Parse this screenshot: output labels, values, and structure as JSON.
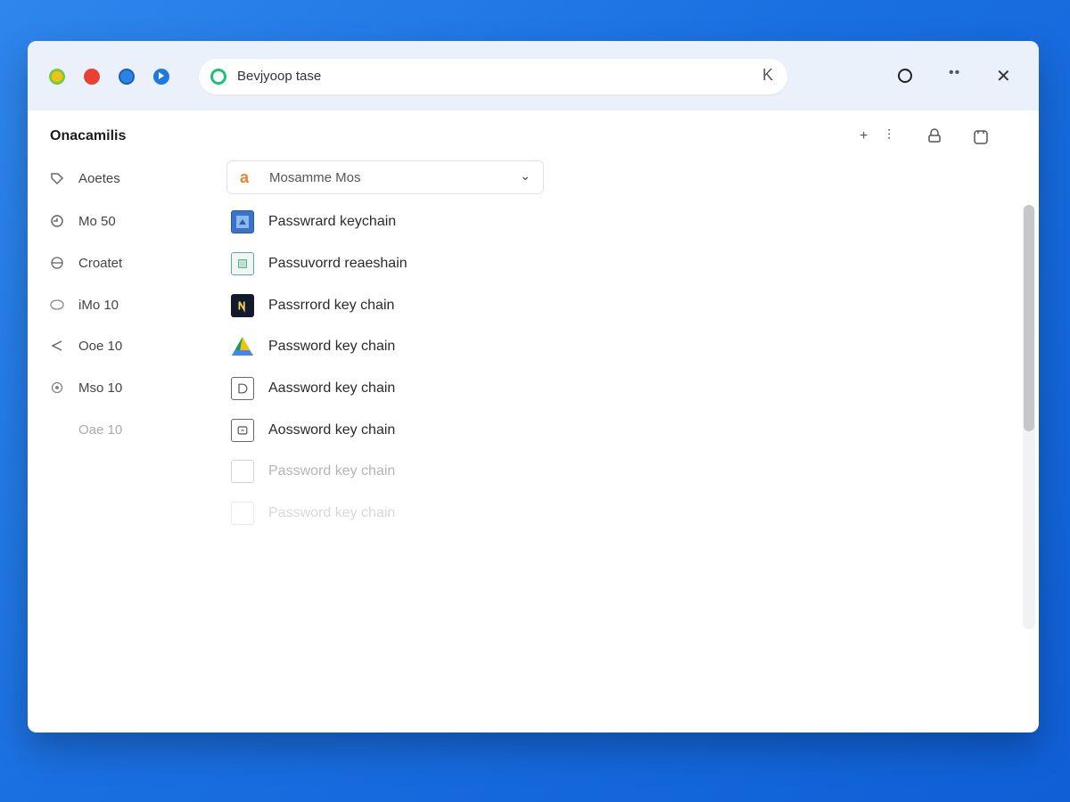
{
  "titlebar": {
    "url_text": "Bevjyoop tase",
    "url_clear_glyph": "K"
  },
  "app": {
    "title": "Onacamilis"
  },
  "sidebar": {
    "items": [
      {
        "label": "Aoetes",
        "icon": "tag-icon"
      },
      {
        "label": "Mo 50",
        "icon": "clock-icon"
      },
      {
        "label": "Croatet",
        "icon": "globe-icon"
      },
      {
        "label": "iMo 10",
        "icon": "oval-icon"
      },
      {
        "label": "Ooe 10",
        "icon": "back-arrow-icon"
      },
      {
        "label": "Mso 10",
        "icon": "settings-icon"
      },
      {
        "label": "Oae 10",
        "icon": "none"
      }
    ]
  },
  "dropdown": {
    "label": "Mosamme Mos",
    "icon": "a-logo-icon",
    "accent": "#e8832c"
  },
  "entries": [
    {
      "label": "Passwrard keychain",
      "icon": "blue-app-icon"
    },
    {
      "label": "Passuvorrd reaeshain",
      "icon": "green-box-icon"
    },
    {
      "label": "Passrrord key chain",
      "icon": "dark-app-icon"
    },
    {
      "label": "Password key chain",
      "icon": "triangle-drive-icon"
    },
    {
      "label": "Aassword key chain",
      "icon": "outline-d-icon"
    },
    {
      "label": "Aossword key chain",
      "icon": "outline-square-icon"
    },
    {
      "label": "Password key chain",
      "icon": "doc-icon"
    },
    {
      "label": "Password key chain",
      "icon": "doc-icon"
    }
  ],
  "colors": {
    "background": "#1a6fe0",
    "titlebar": "#eaf1fb",
    "accent_green": "#1fbf77",
    "red": "#e84033",
    "blue": "#2a84e6"
  }
}
